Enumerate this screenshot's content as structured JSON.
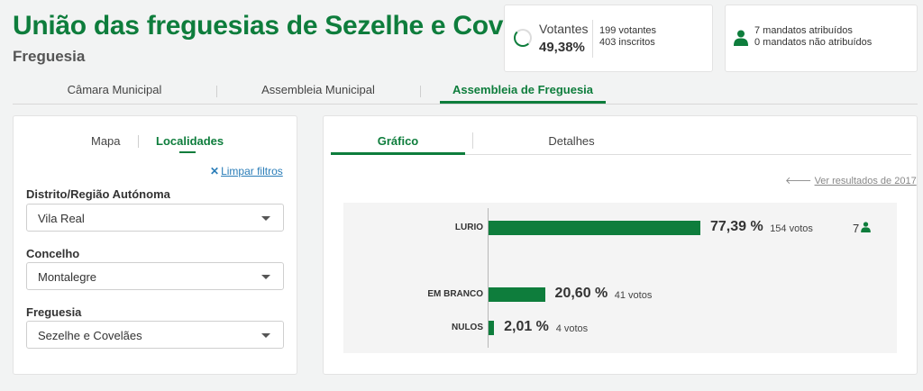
{
  "header": {
    "title": "União das freguesias de Sezelhe e Covelães",
    "subtitle": "Freguesia"
  },
  "votantes": {
    "label": "Votantes",
    "percent": "49,38%",
    "percent_value": 49.38,
    "votantes_text": "199 votantes",
    "inscritos_text": "403 inscritos"
  },
  "mandatos": {
    "icon": "person-icon",
    "atribuidos": "7 mandatos atribuídos",
    "nao_atribuidos": "0 mandatos não atribuídos"
  },
  "main_tabs": [
    {
      "label": "Câmara Municipal",
      "active": false
    },
    {
      "label": "Assembleia Municipal",
      "active": false
    },
    {
      "label": "Assembleia de Freguesia",
      "active": true
    }
  ],
  "filters": {
    "tabs": [
      {
        "label": "Mapa",
        "active": false
      },
      {
        "label": "Localidades",
        "active": true
      }
    ],
    "clear_icon": "close-icon",
    "clear_label": "Limpar filtros",
    "distrito_label": "Distrito/Região Autónoma",
    "distrito_value": "Vila Real",
    "concelho_label": "Concelho",
    "concelho_value": "Montalegre",
    "freguesia_label": "Freguesia",
    "freguesia_value": "Sezelhe e Covelães"
  },
  "results": {
    "tabs": [
      {
        "label": "Gráfico",
        "active": true
      },
      {
        "label": "Detalhes",
        "active": false
      }
    ],
    "prev_link_icon": "arrow-left-icon",
    "prev_link": "Ver resultados de 2017"
  },
  "colors": {
    "accent": "#0e7d3c",
    "link": "#2a7db8"
  },
  "chart_data": {
    "type": "bar",
    "orientation": "horizontal",
    "categories": [
      "LURIO",
      "EM BRANCO",
      "NULOS"
    ],
    "values": [
      77.39,
      20.6,
      2.01
    ],
    "value_labels": [
      "77,39 %",
      "20,60 %",
      "2,01 %"
    ],
    "votes_labels": [
      "154 votos",
      "41 votos",
      "4 votos"
    ],
    "votes": [
      154,
      41,
      4
    ],
    "seats": [
      "7",
      "",
      ""
    ],
    "xlim": [
      0,
      100
    ],
    "grid": false,
    "title": "",
    "xlabel": "",
    "ylabel": ""
  }
}
